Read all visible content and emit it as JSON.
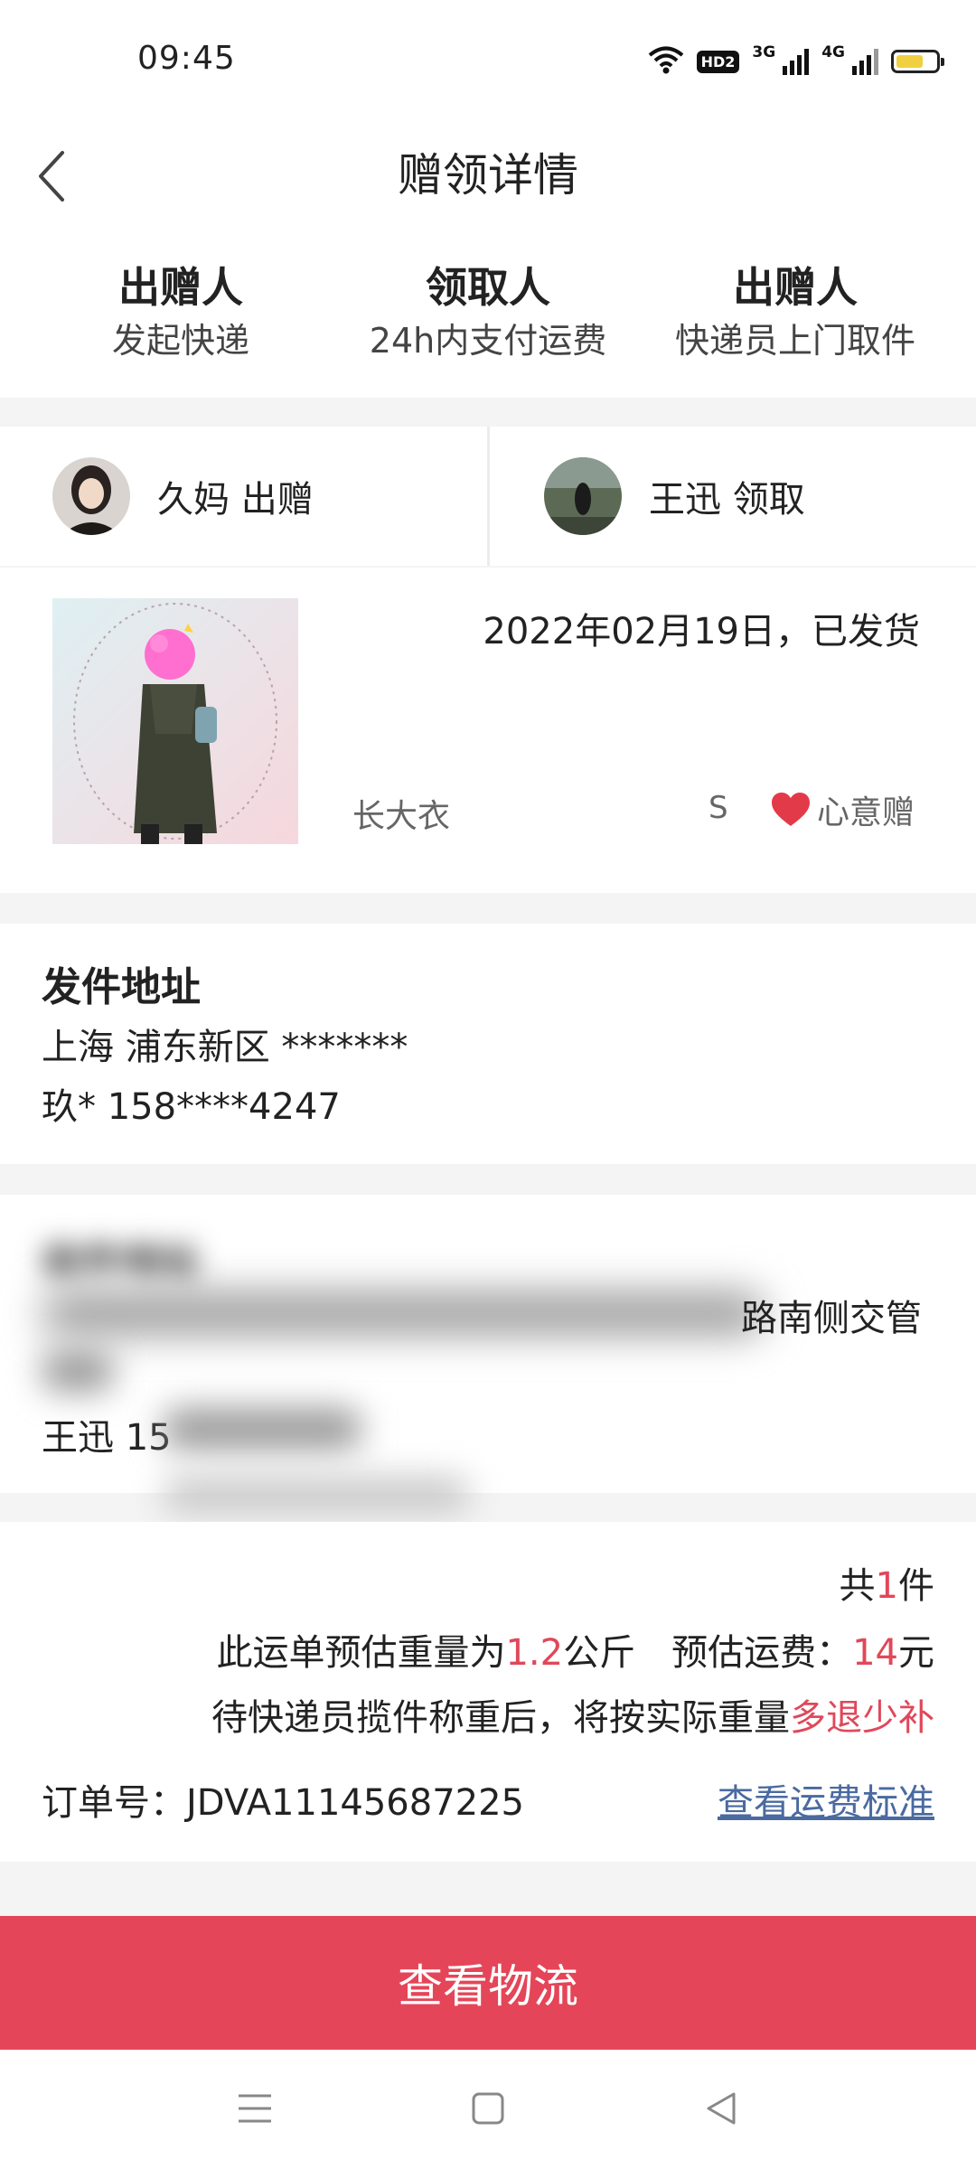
{
  "status_bar": {
    "time": "09:45",
    "hd_badge": "HD2",
    "signal_1_label": "3G",
    "signal_2_label": "4G",
    "battery_level": 0.7,
    "icons": [
      "wifi-icon",
      "hd-icon",
      "signal-3g-icon",
      "signal-4g-icon",
      "battery-icon"
    ]
  },
  "header": {
    "back_icon": "chevron-left-icon",
    "title": "赠领详情"
  },
  "steps": [
    {
      "title": "出赠人",
      "desc": "发起快递"
    },
    {
      "title": "领取人",
      "desc": "24h内支付运费"
    },
    {
      "title": "出赠人",
      "desc": "快递员上门取件"
    }
  ],
  "parties": {
    "giver": {
      "text": "久妈 出赠"
    },
    "receiver": {
      "text": "王迅 领取"
    }
  },
  "item": {
    "ship_status": "2022年02月19日，已发货",
    "name": "长大衣",
    "size": "S",
    "gift_type": "心意赠",
    "gift_icon": "heart-icon"
  },
  "sender_address": {
    "title": "发件地址",
    "line1": "上海 浦东新区 *******",
    "line2": "玖* 158****4247"
  },
  "receiver_address": {
    "title": "收件地址",
    "line1_visible_end": "路南侧交管",
    "line3_visible_start": "王迅 15"
  },
  "fee": {
    "count_prefix": "共",
    "count": "1",
    "count_suffix": "件",
    "weight_prefix": "此运单预估重量为",
    "weight": "1.2",
    "weight_unit": "公斤",
    "fee_prefix": "预估运费：",
    "fee_value": "14",
    "fee_unit": "元",
    "note_prefix": "待快递员揽件称重后，将按实际重量",
    "note_highlight": "多退少补",
    "order_label": "订单号：JDVA11145687225",
    "fee_standard_link": "查看运费标准"
  },
  "actions": {
    "track_button": "查看物流"
  },
  "nav_bar": {
    "icons": [
      "menu-icon",
      "home-square-icon",
      "back-triangle-icon"
    ]
  }
}
